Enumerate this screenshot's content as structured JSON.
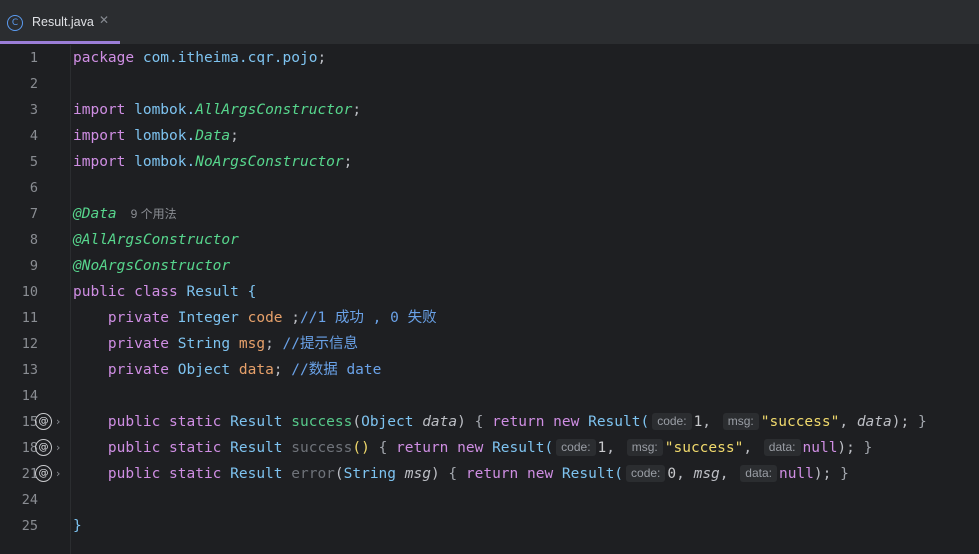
{
  "tab": {
    "icon": "class-icon",
    "icon_letter": "C",
    "filename": "Result.java",
    "close_glyph": "✕"
  },
  "gutter": {
    "override_glyph": "@",
    "fold_glyph": "›"
  },
  "lines": {
    "l1": {
      "num": "1",
      "kw": "package",
      "pkg": " com.itheima.cqr.pojo",
      "end": ";"
    },
    "l2": {
      "num": "2"
    },
    "l3": {
      "num": "3",
      "kw": "import",
      "pkg": " lombok.",
      "ann": "AllArgsConstructor",
      "end": ";"
    },
    "l4": {
      "num": "4",
      "kw": "import",
      "pkg": " lombok.",
      "ann": "Data",
      "end": ";"
    },
    "l5": {
      "num": "5",
      "kw": "import",
      "pkg": " lombok.",
      "ann": "NoArgsConstructor",
      "end": ";"
    },
    "l6": {
      "num": "6"
    },
    "l7": {
      "num": "7",
      "ann": "@Data",
      "usages": "9 个用法"
    },
    "l8": {
      "num": "8",
      "ann": "@AllArgsConstructor"
    },
    "l9": {
      "num": "9",
      "ann": "@NoArgsConstructor"
    },
    "l10": {
      "num": "10",
      "kw": "public class ",
      "cls": "Result ",
      "brace": "{"
    },
    "l11": {
      "num": "11",
      "indent": "    ",
      "kw": "private ",
      "type": "Integer ",
      "field": "code ",
      "end": ";",
      "comment": "//1 成功 , 0 失败"
    },
    "l12": {
      "num": "12",
      "indent": "    ",
      "kw": "private ",
      "type": "String ",
      "field": "msg",
      "end": "; ",
      "comment": "//提示信息"
    },
    "l13": {
      "num": "13",
      "indent": "    ",
      "kw": "private ",
      "type": "Object ",
      "field": "data",
      "end": "; ",
      "comment": "//数据 date"
    },
    "l14": {
      "num": "14"
    },
    "l15": {
      "num": "15",
      "indent": "    ",
      "kw1": "public static ",
      "type1": "Result ",
      "method": "success",
      "p_open": "(",
      "ptype": "Object ",
      "pname": "data",
      "p_close": ") ",
      "b_open": "{ ",
      "ret": "return new ",
      "ctor": "Result(",
      "hint1": "code:",
      "v1": "1",
      "c1": ", ",
      "hint2": "msg:",
      "v2": "\"success\"",
      "c2": ", ",
      "v3": "data",
      "close": "); ",
      "b_close": "}"
    },
    "l18": {
      "num": "18",
      "indent": "    ",
      "kw1": "public static ",
      "type1": "Result ",
      "method": "success",
      "paren": "() ",
      "b_open": "{ ",
      "ret": "return new ",
      "ctor": "Result(",
      "hint1": "code:",
      "v1": "1",
      "c1": ", ",
      "hint2": "msg:",
      "v2": "\"success\"",
      "c2": ", ",
      "hint3": "data:",
      "v3": "null",
      "close": "); ",
      "b_close": "}"
    },
    "l21": {
      "num": "21",
      "indent": "    ",
      "kw1": "public static ",
      "type1": "Result ",
      "method": "error",
      "p_open": "(",
      "ptype": "String ",
      "pname": "msg",
      "p_close": ") ",
      "b_open": "{ ",
      "ret": "return new ",
      "ctor": "Result(",
      "hint1": "code:",
      "v1": "0",
      "c1": ", ",
      "v2": "msg",
      "c2": ", ",
      "hint3": "data:",
      "v3": "null",
      "close": "); ",
      "b_close": "}"
    },
    "l24": {
      "num": "24"
    },
    "l25": {
      "num": "25",
      "brace": "}"
    }
  },
  "colors": {
    "background": "#1e1f22",
    "tab_underline": "#9b7ed8",
    "keyword": "#cf8ee3",
    "annotation": "#57d68d",
    "string": "#f0d96c",
    "comment": "#6aa2e8",
    "field": "#e6a06a"
  }
}
